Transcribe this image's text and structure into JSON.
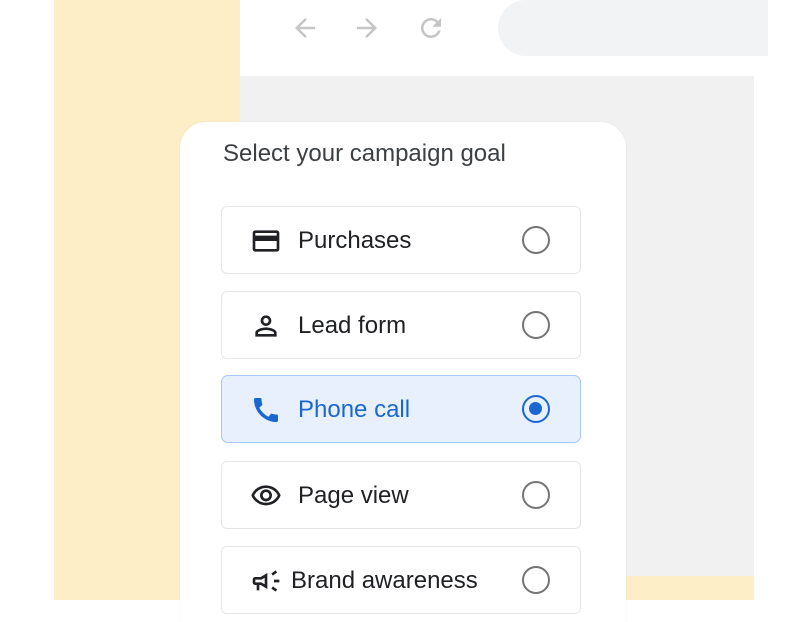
{
  "browser": {
    "back_icon": "arrow-back-icon",
    "forward_icon": "arrow-forward-icon",
    "reload_icon": "reload-icon"
  },
  "card": {
    "title": "Select your campaign goal"
  },
  "options": [
    {
      "label": "Purchases",
      "icon": "credit-card-icon",
      "selected": false
    },
    {
      "label": "Lead form",
      "icon": "person-icon",
      "selected": false
    },
    {
      "label": "Phone call",
      "icon": "phone-icon",
      "selected": true
    },
    {
      "label": "Page view",
      "icon": "eye-icon",
      "selected": false
    },
    {
      "label": "Brand awareness",
      "icon": "megaphone-icon",
      "selected": false
    }
  ],
  "colors": {
    "accent": "#1a67d2",
    "selected_bg": "#e8f0fe",
    "background_panel": "#fdeec7"
  }
}
